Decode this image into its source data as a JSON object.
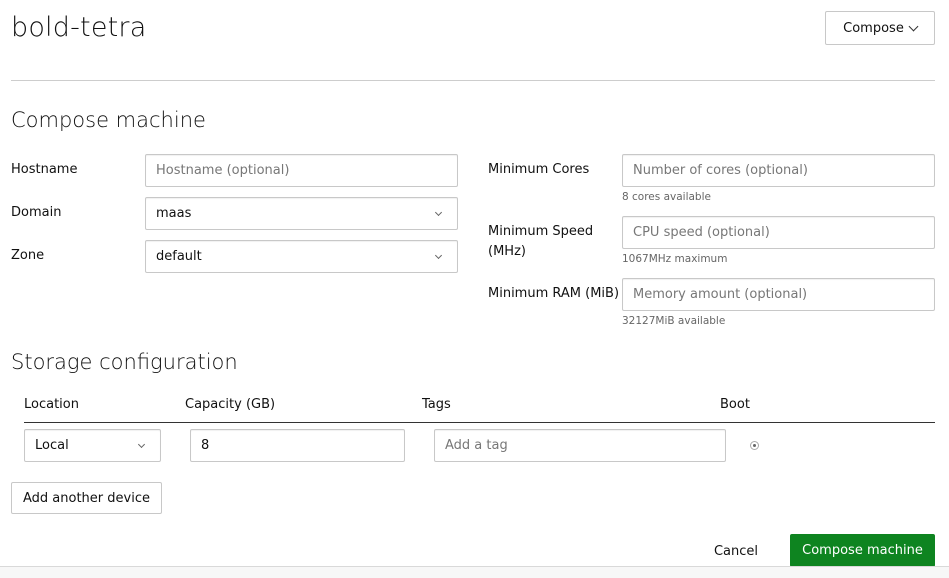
{
  "header": {
    "title": "bold-tetra",
    "compose_button": "Compose"
  },
  "compose_section": {
    "title": "Compose machine",
    "hostname": {
      "label": "Hostname",
      "value": "",
      "placeholder": "Hostname (optional)"
    },
    "domain": {
      "label": "Domain",
      "value": "maas"
    },
    "zone": {
      "label": "Zone",
      "value": "default"
    },
    "min_cores": {
      "label": "Minimum Cores",
      "value": "",
      "placeholder": "Number of cores (optional)",
      "help": "8 cores available"
    },
    "min_speed": {
      "label_line1": "Minimum Speed",
      "label_line2": "(MHz)",
      "value": "",
      "placeholder": "CPU speed (optional)",
      "help": "1067MHz maximum"
    },
    "min_ram": {
      "label": "Minimum RAM (MiB)",
      "value": "",
      "placeholder": "Memory amount (optional)",
      "help": "32127MiB available"
    }
  },
  "storage_section": {
    "title": "Storage configuration",
    "columns": [
      "Location",
      "Capacity (GB)",
      "Tags",
      "Boot"
    ],
    "rows": [
      {
        "location": "Local",
        "capacity": "8",
        "tags": "",
        "tags_placeholder": "Add a tag",
        "boot": true
      }
    ],
    "add_device_button": "Add another device"
  },
  "footer": {
    "cancel": "Cancel",
    "submit": "Compose machine"
  },
  "colors": {
    "primary": "#0e8420"
  }
}
